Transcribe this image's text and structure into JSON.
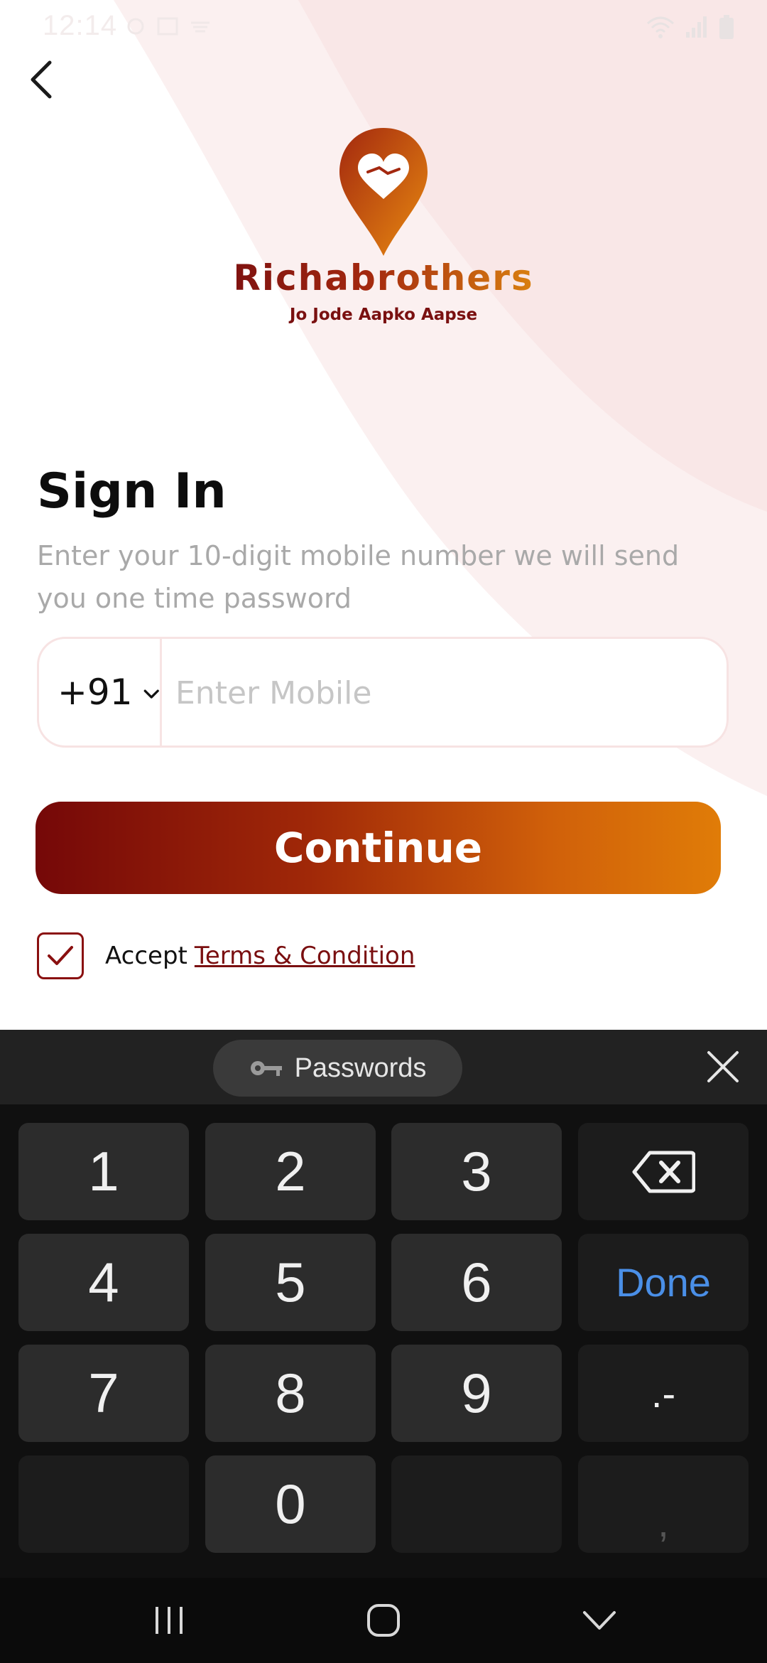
{
  "status_bar": {
    "time": "12:14"
  },
  "brand": {
    "name": "Richabrothers",
    "tagline": "Jo Jode Aapko Aapse"
  },
  "signin": {
    "title": "Sign In",
    "subtitle": "Enter your 10-digit mobile number we will send you one time password"
  },
  "phone": {
    "country_code": "+91",
    "placeholder": "Enter Mobile",
    "value": ""
  },
  "continue_label": "Continue",
  "terms": {
    "accept_label": "Accept",
    "link_label": "Terms & Condition",
    "checked": true
  },
  "keyboard": {
    "toolbar_label": "Passwords",
    "keys": {
      "k1": "1",
      "k2": "2",
      "k3": "3",
      "k4": "4",
      "k5": "5",
      "k6": "6",
      "k7": "7",
      "k8": "8",
      "k9": "9",
      "k0": "0",
      "done": "Done",
      "punct": ".-",
      "comma": ","
    }
  },
  "colors": {
    "brand_dark": "#7a0f10",
    "brand_orange": "#e07c08",
    "done_blue": "#4a8fe7",
    "keyboard_bg": "#101010"
  },
  "icons": [
    "back-arrow",
    "location-pin-heart-handshake",
    "chevron-down",
    "checkmark",
    "key",
    "close",
    "backspace",
    "recents",
    "home",
    "hide-keyboard"
  ]
}
